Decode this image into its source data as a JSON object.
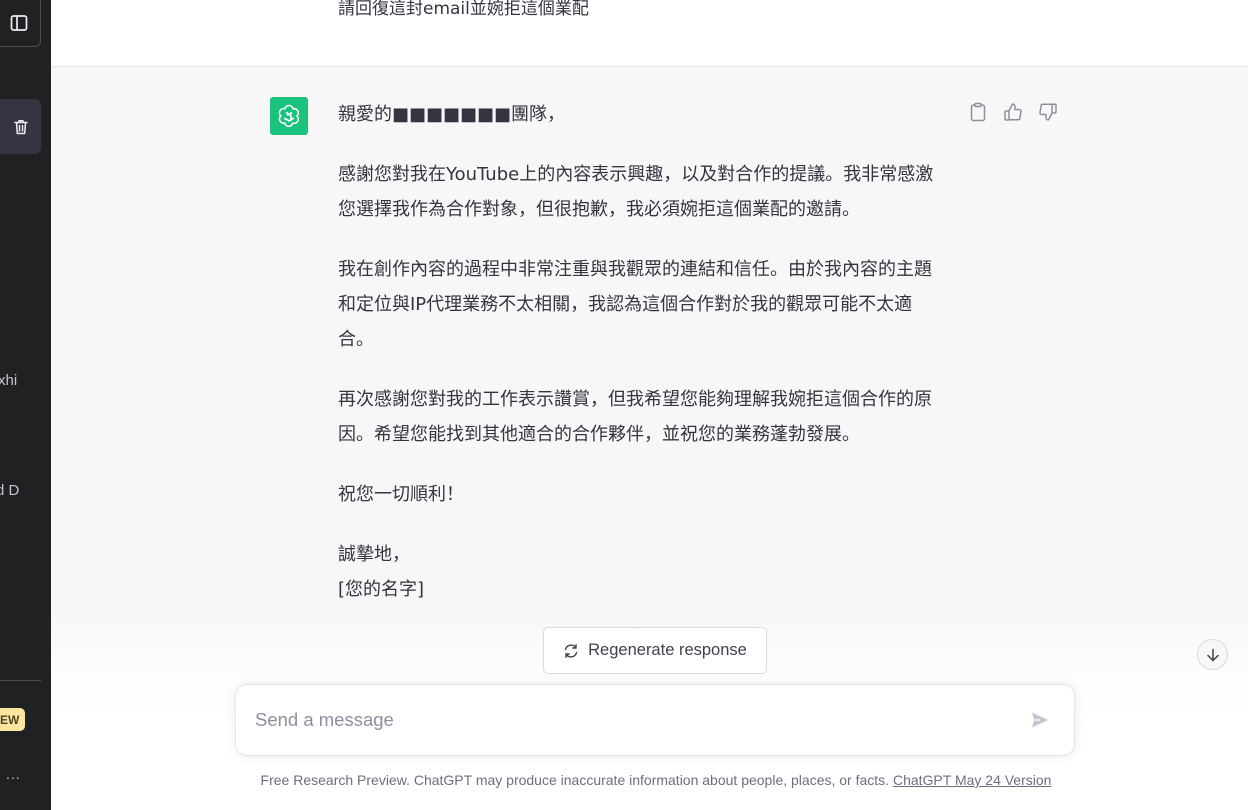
{
  "sidebar": {
    "partial_text_1": "xhi",
    "partial_text_2": "d D",
    "badge": "EW",
    "more": "..."
  },
  "user_message": {
    "text": "請回復這封email並婉拒這個業配"
  },
  "assistant_message": {
    "paragraphs": [
      "親愛的■■■■■■■團隊，",
      "感謝您對我在YouTube上的內容表示興趣，以及對合作的提議。我非常感激您選擇我作為合作對象，但很抱歉，我必須婉拒這個業配的邀請。",
      "我在創作內容的過程中非常注重與我觀眾的連結和信任。由於我內容的主題和定位與IP代理業務不太相關，我認為這個合作對於我的觀眾可能不太適合。",
      "再次感謝您對我的工作表示讚賞，但我希望您能夠理解我婉拒這個合作的原因。希望您能找到其他適合的合作夥伴，並祝您的業務蓬勃發展。",
      "祝您一切順利！"
    ],
    "closing": "誠摯地，",
    "signature": "[您的名字]"
  },
  "regenerate": {
    "label": "Regenerate response"
  },
  "composer": {
    "placeholder": "Send a message"
  },
  "footer": {
    "disclaimer": "Free Research Preview. ChatGPT may produce inaccurate information about people, places, or facts. ",
    "version_link": "ChatGPT May 24 Version"
  },
  "colors": {
    "sidebar_bg": "#202123",
    "assistant_row_bg": "#f7f7f8",
    "avatar_bg": "#19c37d",
    "badge_bg": "#fae69e"
  }
}
